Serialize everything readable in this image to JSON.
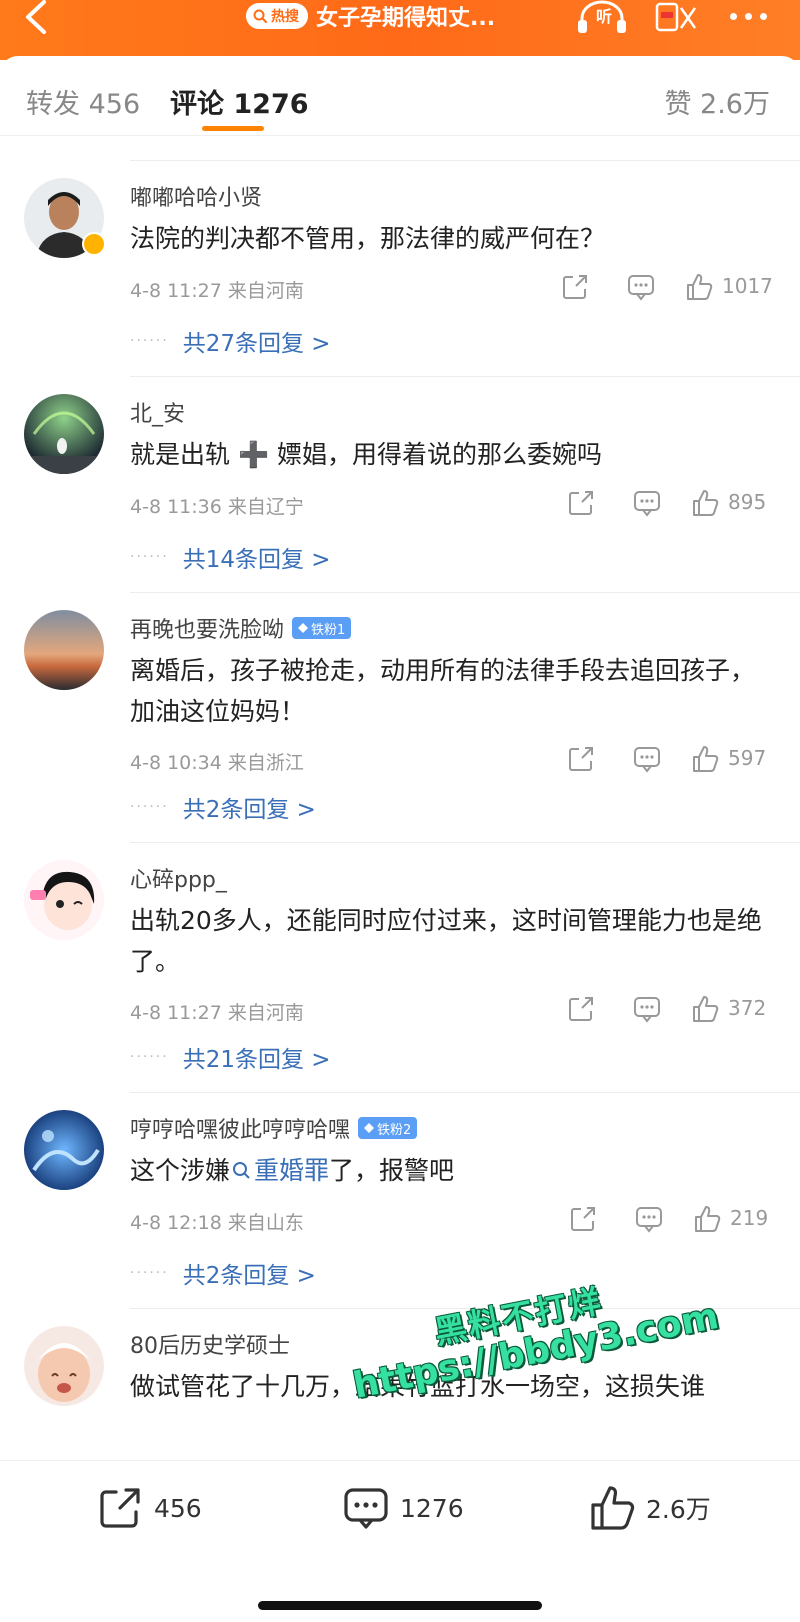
{
  "header": {
    "hot_search_label": "热搜",
    "title": "女子孕期得知丈...",
    "listen_label": "听"
  },
  "tabs": {
    "repost": "转发 456",
    "comment": "评论 1276",
    "like": "赞 2.6万"
  },
  "comments": [
    {
      "username": "嘟嘟哈哈小贤",
      "verified": true,
      "text": "法院的判决都不管用，那法律的威严何在？",
      "meta": "4-8 11:27 来自河南",
      "likes": "1017",
      "replies": "共27条回复 >"
    },
    {
      "username": "北_安",
      "text": "就是出轨 ➕ 嫖娼，用得着说的那么委婉吗",
      "meta": "4-8 11:36 来自辽宁",
      "likes": "895",
      "replies": "共14条回复 >"
    },
    {
      "username": "再晚也要洗脸呦",
      "fan_badge": "铁粉1",
      "text": "离婚后，孩子被抢走，动用所有的法律手段去追回孩子，加油这位妈妈！",
      "meta": "4-8 10:34 来自浙江",
      "likes": "597",
      "replies": "共2条回复 >"
    },
    {
      "username": "心碎ppp_",
      "text": "出轨20多人，还能同时应付过来，这时间管理能力也是绝了。",
      "meta": "4-8 11:27 来自河南",
      "likes": "372",
      "replies": "共21条回复 >"
    },
    {
      "username": "哼哼哈嘿彼此哼哼哈嘿",
      "fan_badge": "铁粉2",
      "text_before": "这个涉嫌",
      "topic": "重婚罪",
      "text_after": "了，报警吧",
      "meta": "4-8 12:18 来自山东",
      "likes": "219",
      "replies": "共2条回复 >"
    },
    {
      "username": "80后历史学硕士",
      "text": "做试管花了十几万，结果竹篮打水一场空，这损失谁"
    }
  ],
  "watermark": {
    "line1": "黑料不打烊",
    "line2": "https://bbdy3.com"
  },
  "bottom_bar": {
    "share_count": "456",
    "comment_count": "1276",
    "like_count": "2.6万"
  },
  "colors": {
    "header_orange": "#ff6d18",
    "tab_underline": "#ff8200",
    "link_blue": "#3a6fb8",
    "fan_badge_blue": "#5a9ef5"
  }
}
